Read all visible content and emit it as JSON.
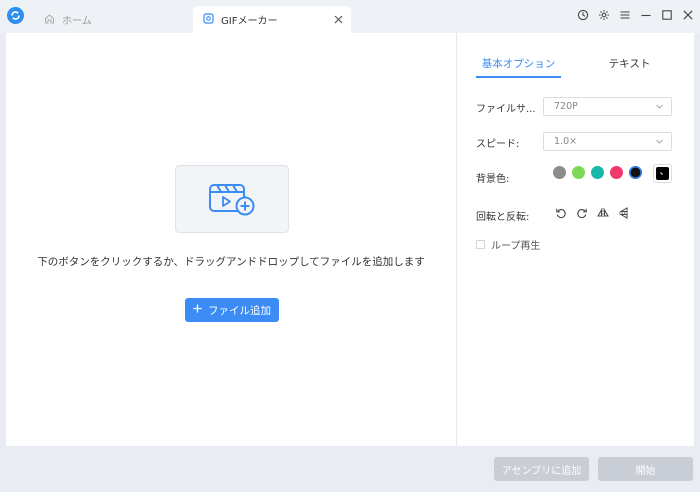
{
  "tabs": {
    "home_label": "ホーム",
    "gif_label": "GIFメーカー"
  },
  "main": {
    "instruction": "下のボタンをクリックするか、ドラッグアンドドロップしてファイルを追加します",
    "add_file_label": "ファイル追加"
  },
  "options": {
    "tab_basic": "基本オプション",
    "tab_text": "テキスト",
    "file_size_label": "ファイルサ...",
    "file_size_value": "720P",
    "speed_label": "スピード:",
    "speed_value": "1.0×",
    "bg_color_label": "背景色:",
    "bg_colors": [
      "#8c8c8c",
      "#7ed957",
      "#17b8a6",
      "#f0386b",
      "#111111"
    ],
    "rotate_label": "回転と反転:",
    "loop_label": "ループ再生"
  },
  "footer": {
    "assembly_label": "アセンブリに追加",
    "start_label": "開始"
  },
  "colors": {
    "accent": "#3b8cf5",
    "disabled": "#c8cdd6"
  },
  "icons": [
    "app-logo-icon",
    "home-icon",
    "gif-icon",
    "close-icon",
    "history-icon",
    "gear-icon",
    "menu-icon",
    "minimize-icon",
    "maximize-icon",
    "window-close-icon",
    "video-add-icon",
    "plus-icon",
    "chevron-down-icon",
    "rotate-left-icon",
    "rotate-right-icon",
    "flip-horizontal-icon",
    "flip-vertical-icon",
    "eyedropper-icon"
  ]
}
